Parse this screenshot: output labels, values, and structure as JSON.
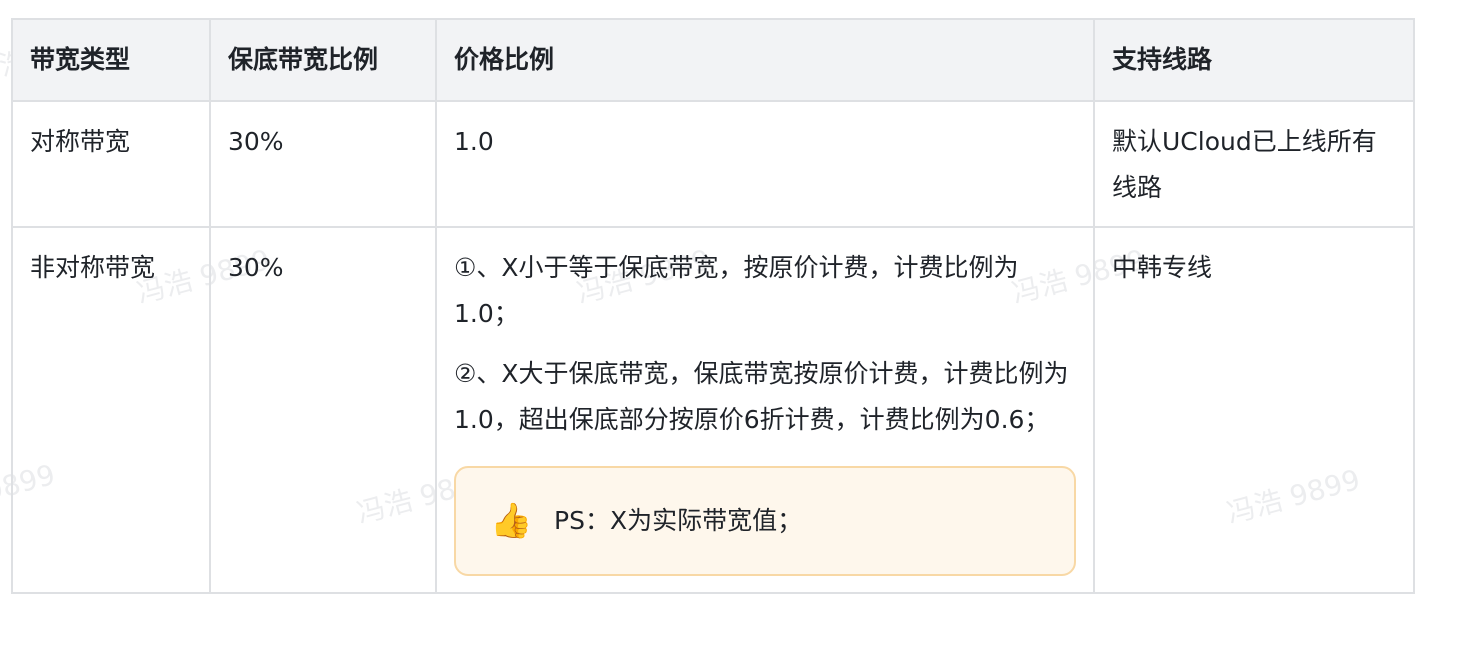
{
  "table": {
    "headers": [
      "带宽类型",
      "保底带宽比例",
      "价格比例",
      "支持线路"
    ],
    "rows": [
      {
        "type": "对称带宽",
        "min_ratio": "30%",
        "price": "1.0",
        "lines": "默认UCloud已上线所有线路"
      },
      {
        "type": "非对称带宽",
        "min_ratio": "30%",
        "price_para1": "①、X小于等于保底带宽，按原价计费，计费比例为1.0；",
        "price_para2": "②、X大于保底带宽，保底带宽按原价计费，计费比例为1.0，超出保底部分按原价6折计费，计费比例为0.6；",
        "callout_icon": "thumbs-up-icon",
        "callout_text": "PS：X为实际带宽值；",
        "lines": "中韩专线"
      }
    ]
  },
  "watermark": {
    "text": "冯浩 9899"
  }
}
